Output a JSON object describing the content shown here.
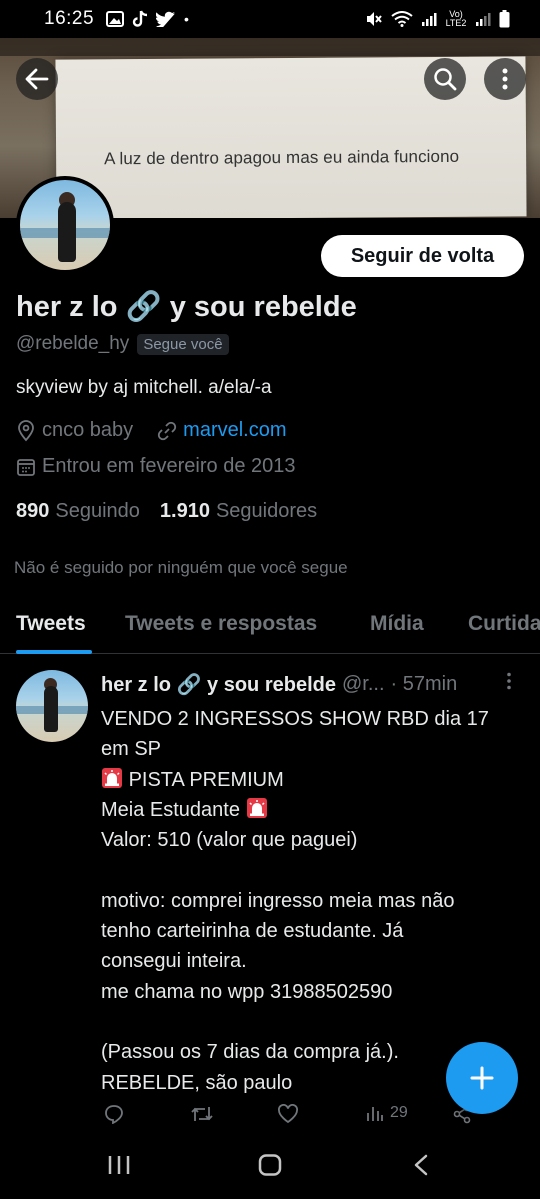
{
  "status_bar": {
    "time": "16:25",
    "network_label": "Vo) LTE2"
  },
  "banner": {
    "text": "A luz de dentro apagou mas eu ainda funciono"
  },
  "profile": {
    "follow_button": "Seguir de volta",
    "display_name": "her z lo 🔗 y sou rebelde",
    "handle": "@rebelde_hy",
    "follows_you": "Segue você",
    "bio": "skyview by aj mitchell. a/ela/-a",
    "location": "cnco baby",
    "website": "marvel.com",
    "joined": "Entrou em fevereiro de 2013",
    "following_count": "890",
    "following_label": "Seguindo",
    "followers_count": "1.910",
    "followers_label": "Seguidores",
    "not_followed_note": "Não é seguido por ninguém que você segue"
  },
  "tabs": [
    {
      "label": "Tweets"
    },
    {
      "label": "Tweets e respostas"
    },
    {
      "label": "Mídia"
    },
    {
      "label": "Curtidas"
    }
  ],
  "tweet": {
    "author_name": "her z lo 🔗 y sou rebelde",
    "author_handle": "@r...",
    "time": "· 57min",
    "lines": [
      "VENDO 2 INGRESSOS SHOW RBD dia 17",
      "em SP",
      "PISTA PREMIUM",
      "Meia Estudante",
      "Valor: 510 (valor que paguei)",
      "",
      "motivo: comprei ingresso meia mas não",
      "tenho carteirinha de estudante. Já",
      "consegui inteira.",
      "me chama no wpp 31988502590",
      "",
      "(Passou os 7 dias da compra já.).",
      "REBELDE, são paulo"
    ],
    "views": "29"
  },
  "colors": {
    "accent": "#1d9bf0",
    "background": "#000000",
    "muted_text": "#71767b"
  }
}
